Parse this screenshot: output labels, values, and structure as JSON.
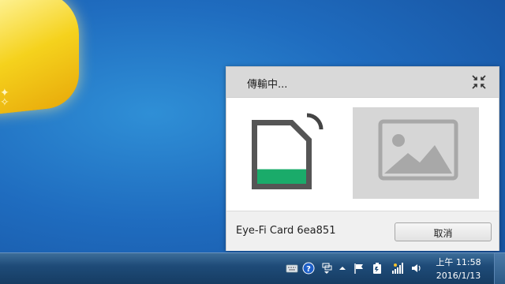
{
  "popup": {
    "title": "傳輸中...",
    "card_name": "Eye-Fi Card 6ea851",
    "cancel_label": "取消",
    "progress_fraction": 0.25,
    "accent_color": "#1aab6a"
  },
  "taskbar": {
    "tray_icons": [
      "keyboard-icon",
      "help-icon",
      "network-connections-icon",
      "chevron-up-icon",
      "action-center-flag-icon",
      "battery-icon",
      "wifi-signal-icon",
      "volume-icon"
    ],
    "clock_time": "上午 11:58",
    "clock_date": "2016/1/13"
  }
}
